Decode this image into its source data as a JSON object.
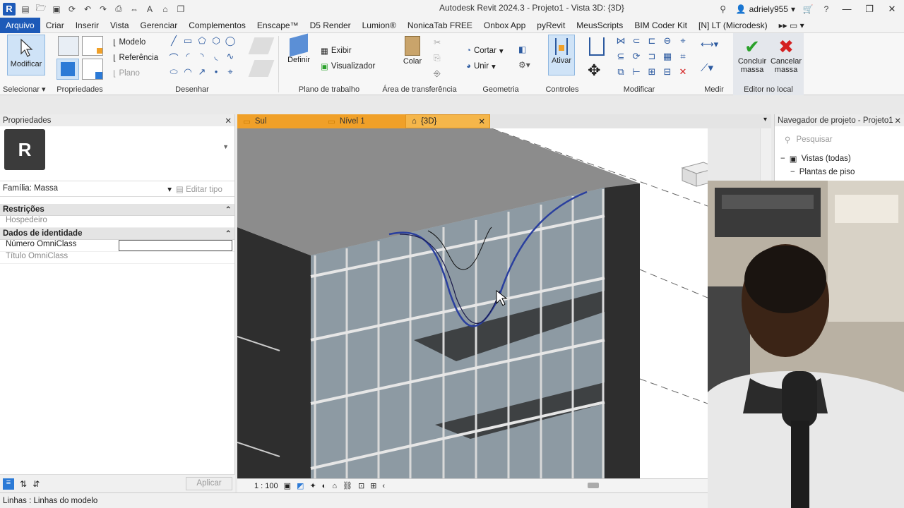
{
  "titlebar": {
    "title": "Autodesk Revit 2024.3 - Projeto1 - Vista 3D: {3D}",
    "username": "adriely955"
  },
  "menu": {
    "tabs": [
      "Arquivo",
      "Criar",
      "Inserir",
      "Vista",
      "Gerenciar",
      "Complementos",
      "Enscape™",
      "D5 Render",
      "Lumion®",
      "NonicaTab FREE",
      "Onbox App",
      "pyRevit",
      "MeusScripts",
      "BIM Coder Kit",
      "[N] LT (Microdesk)"
    ]
  },
  "ribbon": {
    "modify_label": "Modificar",
    "selecionar_label": "Selecionar",
    "propriedades_label": "Propriedades",
    "modelo_label": "Modelo",
    "referencia_label": "Referência",
    "plano_label": "Plano",
    "desenhar_label": "Desenhar",
    "definir_label": "Definir",
    "exibir_label": "Exibir",
    "visualizador_label": "Visualizador",
    "plano_trabalho_label": "Plano de trabalho",
    "colar_label": "Colar",
    "transferencia_label": "Área de transferência",
    "cortar_label": "Cortar",
    "unir_label": "Unir",
    "geometria_label": "Geometria",
    "ativar_label": "Ativar",
    "controles_label": "Controles",
    "modificar_panel_label": "Modificar",
    "medir_label": "Medir",
    "concluir_label": "Concluir massa",
    "cancelar_label": "Cancelar massa",
    "editor_label": "Editor no local"
  },
  "properties": {
    "header": "Propriedades",
    "logo_letter": "R",
    "family": "Família: Massa",
    "edit_type": "Editar tipo",
    "groups": {
      "restricoes": "Restrições",
      "hospedeiro": "Hospedeiro",
      "dados": "Dados de identidade",
      "numero_omniclass": "Número OmniClass",
      "titulo_omniclass": "Título OmniClass"
    },
    "apply": "Aplicar"
  },
  "view_tabs": {
    "tab1": "Sul",
    "tab2": "Nível 1",
    "tab3": "{3D}"
  },
  "view_status": {
    "scale": "1 : 100"
  },
  "browser": {
    "header": "Navegador de projeto - Projeto1",
    "search_placeholder": "Pesquisar",
    "tree": [
      "Vistas (todas)",
      "Plantas de piso"
    ]
  },
  "statusbar": {
    "text": "Linhas : Linhas do modelo"
  },
  "colors": {
    "revit_blue": "#1d5ab8",
    "tab_orange": "#f0a028",
    "ok_green": "#2aa12a",
    "cancel_red": "#d42020"
  }
}
